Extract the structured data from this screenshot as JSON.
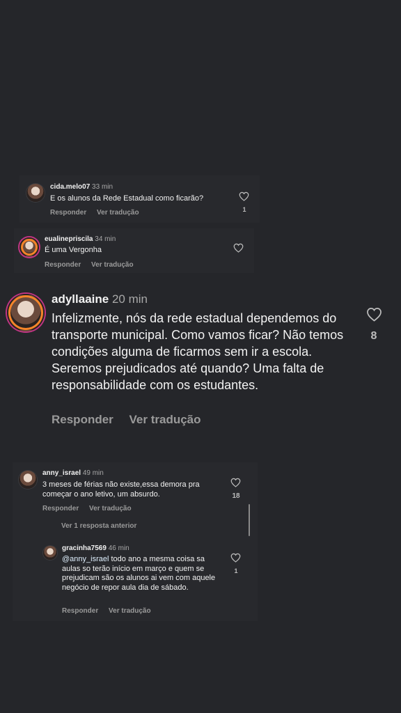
{
  "comments": {
    "c1": {
      "username": "cida.melo07",
      "time": "33 min",
      "text": "E os alunos da Rede Estadual  como ficarão?",
      "reply_label": "Responder",
      "translate_label": "Ver tradução",
      "likes": "1"
    },
    "c2": {
      "username": "eualinepriscila",
      "time": "34 min",
      "text": "É uma Vergonha",
      "reply_label": "Responder",
      "translate_label": "Ver tradução"
    },
    "c3": {
      "username": "adyllaaine",
      "time": "20 min",
      "text": "Infelizmente, nós da rede estadual dependemos do transporte municipal. Como vamos ficar? Não temos condições alguma de ficarmos sem ir a escola. Seremos prejudicados até quando? Uma falta de responsabilidade com os estudantes.",
      "reply_label": "Responder",
      "translate_label": "Ver tradução",
      "likes": "8"
    },
    "c4": {
      "username": "anny_israel",
      "time": "49 min",
      "text": "3 meses de férias não existe,essa demora pra começar o ano letivo, um absurdo.",
      "reply_label": "Responder",
      "translate_label": "Ver tradução",
      "likes": "18",
      "view_replies": "Ver 1 resposta anterior"
    },
    "c5": {
      "username": "gracinha7569",
      "time": "46 min",
      "mention": "@anny_israel",
      "text": "  todo ano a mesma coisa sa aulas so terão início em março e quem se prejudicam são os alunos ai vem com aquele negócio de repor aula dia de sábado.",
      "reply_label": "Responder",
      "translate_label": "Ver tradução",
      "likes": "1"
    }
  },
  "icons": {
    "like": "heart-outline-icon"
  },
  "colors": {
    "background": "#25262a",
    "muted": "#a8a8a8",
    "mention": "#e0f1ff"
  }
}
